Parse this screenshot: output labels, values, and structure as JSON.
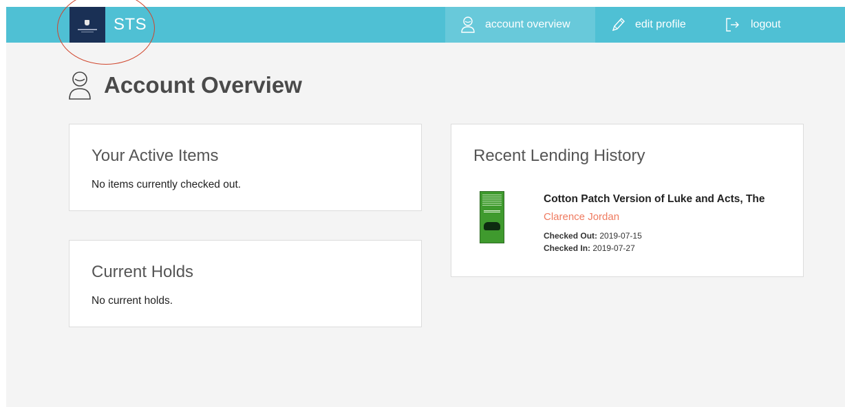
{
  "header": {
    "brand": "STS",
    "nav": [
      {
        "label": "account overview",
        "icon": "user-icon",
        "active": true
      },
      {
        "label": "edit profile",
        "icon": "pencil-icon",
        "active": false
      },
      {
        "label": "logout",
        "icon": "logout-icon",
        "active": false
      }
    ]
  },
  "page": {
    "title": "Account Overview",
    "icon": "user-icon"
  },
  "active_items": {
    "title": "Your Active Items",
    "message": "No items currently checked out."
  },
  "holds": {
    "title": "Current Holds",
    "message": "No current holds."
  },
  "lending_history": {
    "title": "Recent Lending History",
    "items": [
      {
        "title": "Cotton Patch Version of Luke and Acts, The",
        "author": "Clarence Jordan",
        "checked_out_label": "Checked Out:",
        "checked_out": "2019-07-15",
        "checked_in_label": "Checked In:",
        "checked_in": "2019-07-27"
      }
    ]
  },
  "colors": {
    "topbar": "#4fc0d4",
    "topbar_active": "#68c9da",
    "logo_bg": "#1a3055",
    "author_link": "#ef7a5f",
    "annotation_circle": "#d0452c",
    "page_bg": "#f4f4f4"
  }
}
